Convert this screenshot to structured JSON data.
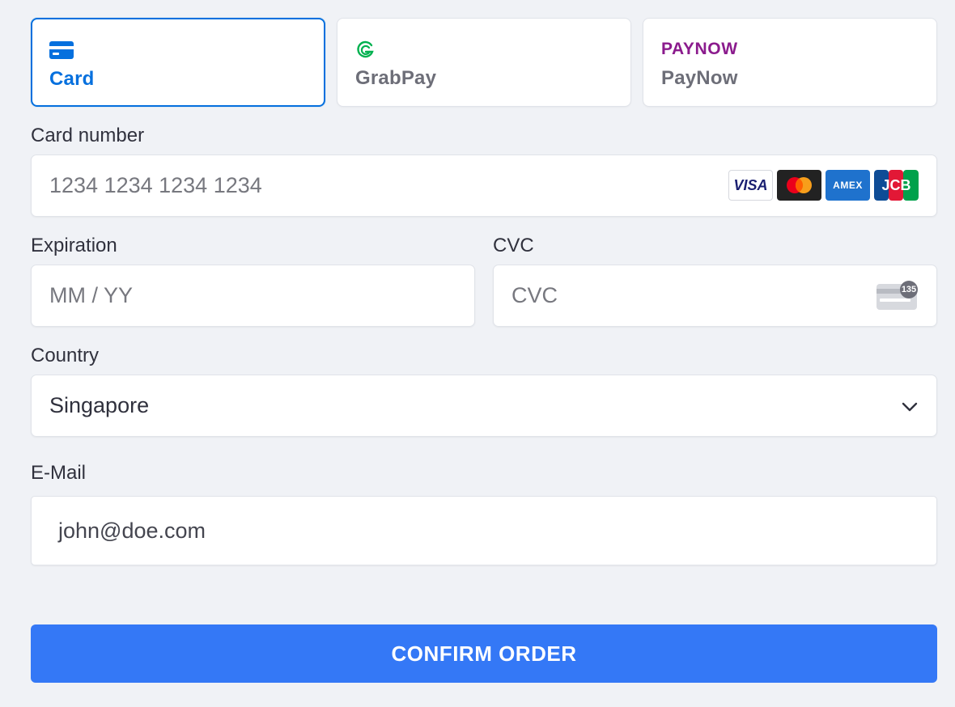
{
  "payment_methods": [
    {
      "label": "Card",
      "icon": "card-icon",
      "selected": true
    },
    {
      "label": "GrabPay",
      "icon": "grabpay-logo-icon",
      "selected": false
    },
    {
      "label": "PayNow",
      "icon": "paynow-logo-icon",
      "selected": false,
      "logo_text": "PAYNOW"
    }
  ],
  "card_number": {
    "label": "Card number",
    "placeholder": "1234 1234 1234 1234",
    "brands": [
      {
        "name": "visa",
        "text": "VISA"
      },
      {
        "name": "mastercard",
        "text": ""
      },
      {
        "name": "amex",
        "text": "AMEX"
      },
      {
        "name": "jcb",
        "text": "JCB"
      }
    ]
  },
  "expiration": {
    "label": "Expiration",
    "placeholder": "MM / YY"
  },
  "cvc": {
    "label": "CVC",
    "placeholder": "CVC",
    "icon_text": "135"
  },
  "country": {
    "label": "Country",
    "value": "Singapore"
  },
  "email": {
    "label": "E-Mail",
    "value": "john@doe.com"
  },
  "confirm_label": "CONFIRM ORDER",
  "colors": {
    "accent": "#0570de",
    "button": "#3478f6",
    "background": "#f0f2f6",
    "paynow": "#8b1b8d",
    "grabpay": "#00b14f"
  }
}
